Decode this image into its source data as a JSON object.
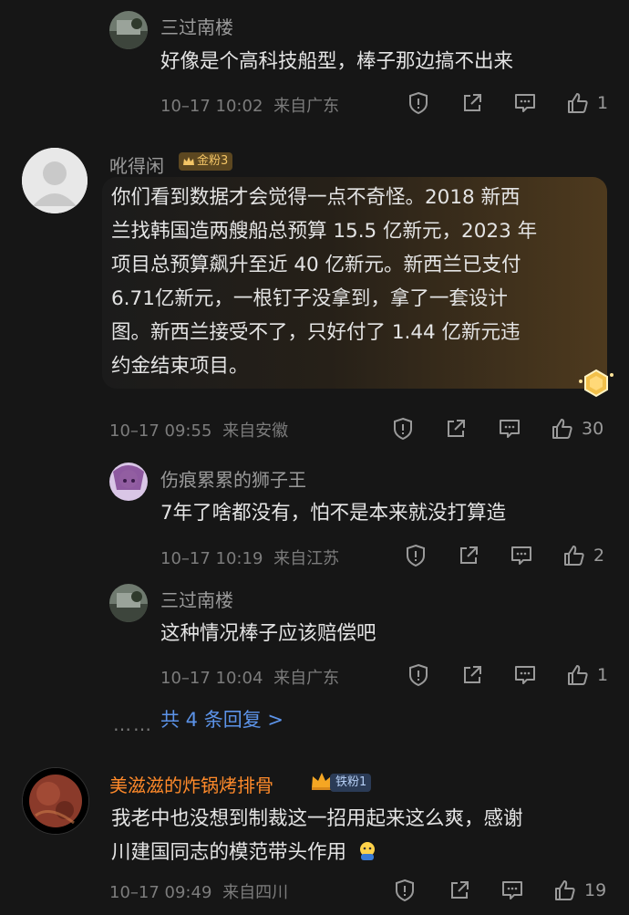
{
  "replies_top": {
    "user": "三过南楼",
    "text": "好像是个高科技船型，棒子那边搞不出来",
    "time": "10–17 10:02",
    "location": "来自广东",
    "likes": "1"
  },
  "comment1": {
    "user": "吪得闲",
    "badge": "金粉3",
    "text_lines": [
      "你们看到数据才会觉得一点不奇怪。2018 新西",
      "兰找韩国造两艘船总预算 15.5 亿新元，2023 年",
      "项目总预算飙升至近 40 亿新元。新西兰已支付",
      "6.71亿新元，一根钉子没拿到，拿了一套设计",
      "图。新西兰接受不了，只好付了 1.44 亿新元违",
      "约金结束项目。"
    ],
    "time": "10–17 09:55",
    "location": "来自安徽",
    "likes": "30"
  },
  "reply1": {
    "user": "伤痕累累的狮子王",
    "text": "7年了啥都没有，怕不是本来就没打算造",
    "time": "10–17 10:19",
    "location": "来自江苏",
    "likes": "2"
  },
  "reply2": {
    "user": "三过南楼",
    "text": "这种情况棒子应该赔偿吧",
    "time": "10–17 10:04",
    "location": "来自广东",
    "likes": "1"
  },
  "more_replies": "共 4 条回复 >",
  "more_dots": "……",
  "comment2": {
    "user": "美滋滋的炸锅烤排骨",
    "badge": "铁粉1",
    "text_lines": [
      "我老中也没想到制裁这一招用起来这么爽，感谢",
      "川建国同志的模范带头作用"
    ],
    "time": "10–17 09:49",
    "location": "来自四川",
    "likes": "19"
  },
  "colors": {
    "background": "#161616",
    "accent_link": "#5c93e8",
    "username_highlight": "#ff8a2a"
  }
}
